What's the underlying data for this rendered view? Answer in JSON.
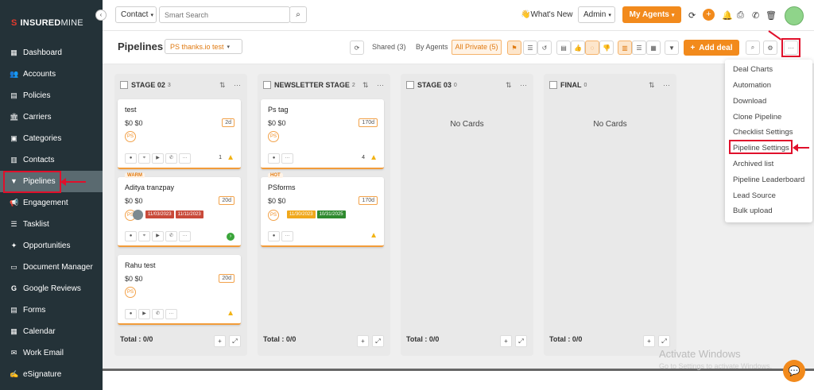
{
  "brand": {
    "logo_prefix": "INSURED",
    "logo_suffix": "MINE"
  },
  "sidebar": {
    "items": [
      {
        "label": "Dashboard",
        "icon": "dashboard-icon"
      },
      {
        "label": "Accounts",
        "icon": "accounts-icon"
      },
      {
        "label": "Policies",
        "icon": "policies-icon"
      },
      {
        "label": "Carriers",
        "icon": "carriers-icon"
      },
      {
        "label": "Categories",
        "icon": "categories-icon"
      },
      {
        "label": "Contacts",
        "icon": "contacts-icon"
      },
      {
        "label": "Pipelines",
        "icon": "filter-icon",
        "active": true
      },
      {
        "label": "Engagement",
        "icon": "megaphone-icon"
      },
      {
        "label": "Tasklist",
        "icon": "tasklist-icon"
      },
      {
        "label": "Opportunities",
        "icon": "opportunities-icon"
      },
      {
        "label": "Document Manager",
        "icon": "folder-icon"
      },
      {
        "label": "Google Reviews",
        "icon": "google-icon"
      },
      {
        "label": "Forms",
        "icon": "forms-icon"
      },
      {
        "label": "Calendar",
        "icon": "calendar-icon"
      },
      {
        "label": "Work Email",
        "icon": "email-icon"
      },
      {
        "label": "eSignature",
        "icon": "signature-icon"
      }
    ]
  },
  "topbar": {
    "search_scope": "Contact",
    "search_placeholder": "Smart Search",
    "whats_new": "What's New",
    "role": "Admin",
    "my_agents": "My Agents"
  },
  "pipeline": {
    "title": "Pipelines",
    "name": "PS thanks.io test",
    "shared": "Shared (3)",
    "by_agents": "By Agents",
    "all_private": "All Private (5)",
    "add_deal": "Add deal"
  },
  "columns": [
    {
      "name": "STAGE 02",
      "count": "3",
      "total": "Total : 0/0",
      "cards": [
        {
          "name": "test",
          "amount": "$0 $0",
          "days": "2d",
          "avatar": "PS",
          "notes": "1"
        },
        {
          "name": "Aditya tranzpay",
          "tag": "WARM",
          "amount": "$0 $0",
          "days": "20d",
          "avatar": "PS",
          "date1": "11/03/2023",
          "date2": "11/11/2023"
        },
        {
          "name": "Rahu test",
          "amount": "$0 $0",
          "days": "20d",
          "avatar": "PS"
        }
      ]
    },
    {
      "name": "NEWSLETTER STAGE",
      "count": "2",
      "total": "Total : 0/0",
      "cards": [
        {
          "name": "Ps tag",
          "amount": "$0 $0",
          "days": "170d",
          "avatar": "PS",
          "notes": "4"
        },
        {
          "name": "PSforms",
          "tag": "HOT",
          "amount": "$0 $0",
          "days": "170d",
          "avatar": "PS",
          "date1": "11/30/2023",
          "date2": "10/31/2025"
        }
      ]
    },
    {
      "name": "STAGE 03",
      "count": "0",
      "total": "Total : 0/0",
      "empty": "No Cards"
    },
    {
      "name": "FINAL",
      "count": "0",
      "total": "Total : 0/0",
      "empty": "No Cards"
    }
  ],
  "menu": {
    "items": [
      "Deal Charts",
      "Automation",
      "Download",
      "Clone Pipeline",
      "Checklist Settings",
      "Pipeline Settings",
      "Archived list",
      "Pipeline Leaderboard",
      "Lead Source",
      "Bulk upload"
    ]
  },
  "watermark": {
    "line1": "Activate Windows",
    "line2": "Go to Settings to activate Windows."
  },
  "colors": {
    "accent": "#f28a1c",
    "sidebar": "#243238",
    "highlight": "#e0102b"
  }
}
